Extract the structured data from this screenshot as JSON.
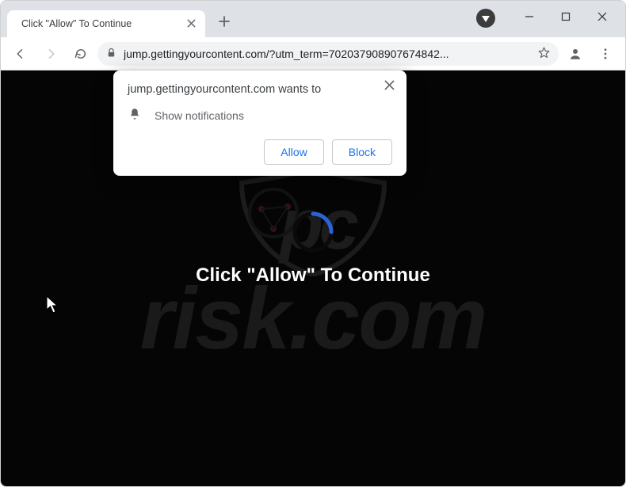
{
  "tab": {
    "title": "Click \"Allow\" To Continue",
    "favicon": "checkmark-icon"
  },
  "omnibox": {
    "url": "jump.gettingyourcontent.com/?utm_term=702037908907674842..."
  },
  "page": {
    "hero": "Click \"Allow\" To Continue",
    "watermark_text": "risk.com"
  },
  "perm": {
    "origin": "jump.gettingyourcontent.com wants to",
    "capability": "Show notifications",
    "allow": "Allow",
    "block": "Block"
  }
}
